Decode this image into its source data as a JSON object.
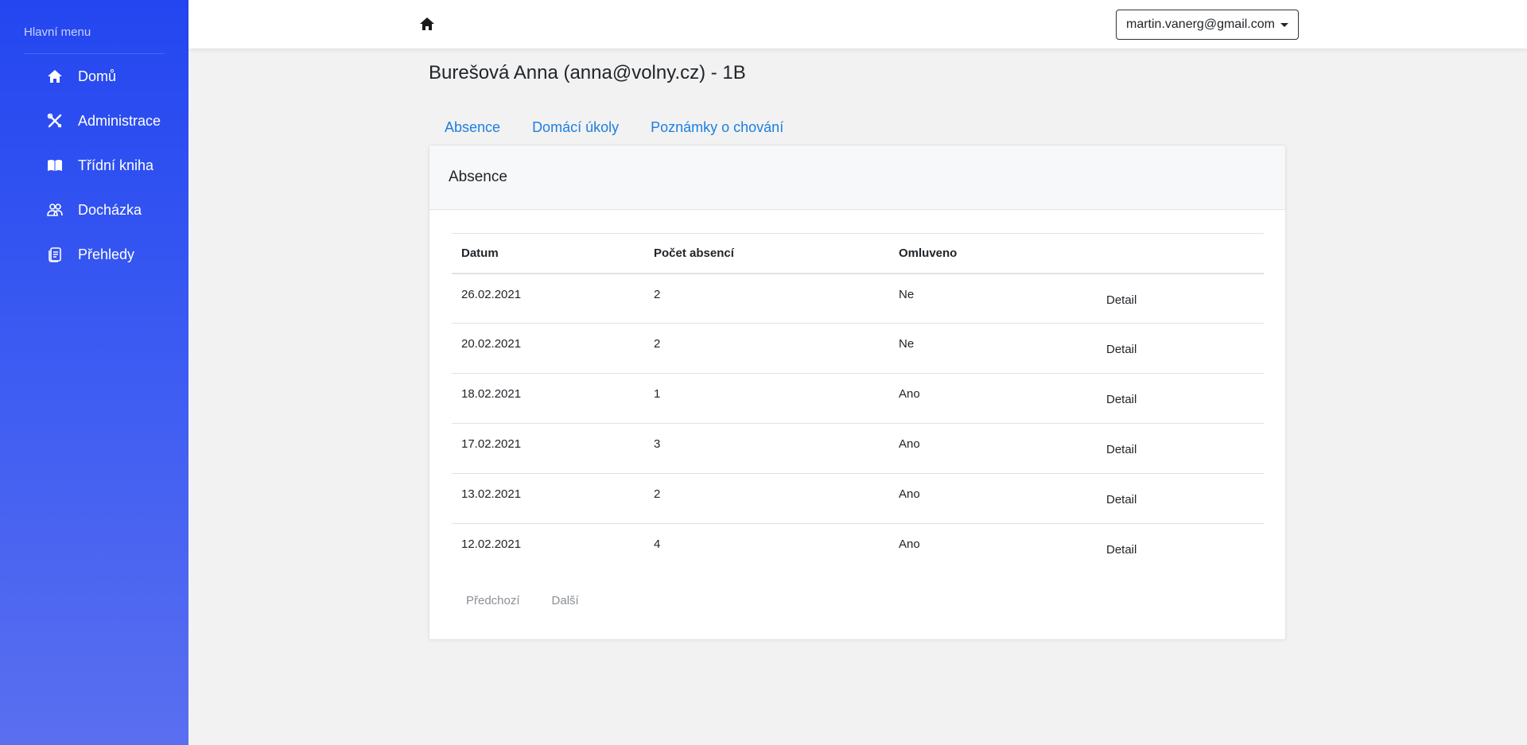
{
  "sidebar": {
    "heading": "Hlavní menu",
    "items": [
      {
        "label": "Domů",
        "icon": "home-icon"
      },
      {
        "label": "Administrace",
        "icon": "tools-icon"
      },
      {
        "label": "Třídní kniha",
        "icon": "book-icon"
      },
      {
        "label": "Docházka",
        "icon": "users-icon"
      },
      {
        "label": "Přehledy",
        "icon": "notes-icon"
      }
    ]
  },
  "topbar": {
    "user_email": "martin.vanerg@gmail.com"
  },
  "page": {
    "title": "Burešová Anna (anna@volny.cz) - 1B"
  },
  "tabs": [
    {
      "label": "Absence"
    },
    {
      "label": "Domácí úkoly"
    },
    {
      "label": "Poznámky o chování"
    }
  ],
  "card": {
    "title": "Absence",
    "columns": [
      "Datum",
      "Počet absencí",
      "Omluveno"
    ],
    "rows": [
      {
        "date": "26.02.2021",
        "count": "2",
        "excused": "Ne",
        "action": "Detail"
      },
      {
        "date": "20.02.2021",
        "count": "2",
        "excused": "Ne",
        "action": "Detail"
      },
      {
        "date": "18.02.2021",
        "count": "1",
        "excused": "Ano",
        "action": "Detail"
      },
      {
        "date": "17.02.2021",
        "count": "3",
        "excused": "Ano",
        "action": "Detail"
      },
      {
        "date": "13.02.2021",
        "count": "2",
        "excused": "Ano",
        "action": "Detail"
      },
      {
        "date": "12.02.2021",
        "count": "4",
        "excused": "Ano",
        "action": "Detail"
      }
    ],
    "pager": {
      "prev": "Předchozí",
      "next": "Další"
    }
  },
  "colors": {
    "sidebar_top": "#2346f0",
    "sidebar_bottom": "#5a6ff0",
    "link": "#1d7fe0"
  }
}
